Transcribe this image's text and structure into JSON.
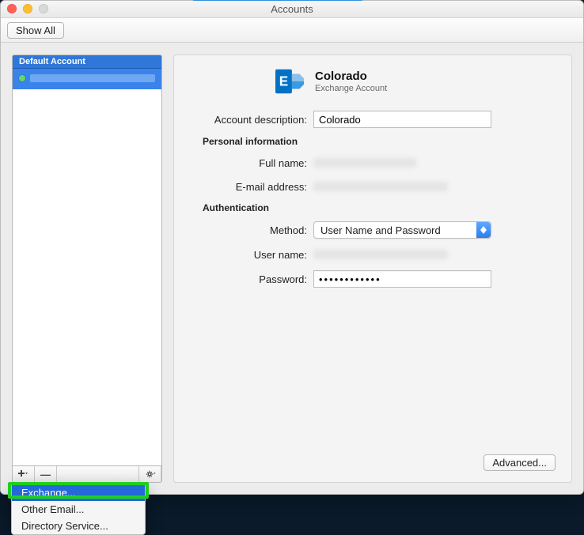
{
  "window": {
    "title": "Accounts"
  },
  "toolbar": {
    "show_all_label": "Show All"
  },
  "sidebar": {
    "header": "Default Account",
    "controls": {
      "add": "+",
      "remove": "−",
      "settings": "⚙"
    }
  },
  "popup": {
    "items": [
      {
        "label": "Exchange...",
        "selected": true
      },
      {
        "label": "Other Email..."
      },
      {
        "label": "Directory Service..."
      }
    ]
  },
  "detail": {
    "account_name": "Colorado",
    "account_type_label": "Exchange Account",
    "labels": {
      "description": "Account description:",
      "personal_section": "Personal information",
      "fullname": "Full name:",
      "email": "E-mail address:",
      "auth_section": "Authentication",
      "method": "Method:",
      "username": "User name:",
      "password": "Password:"
    },
    "values": {
      "description": "Colorado",
      "method": "User Name and Password",
      "password": "••••••••••••"
    },
    "advanced_label": "Advanced..."
  },
  "colors": {
    "selection": "#2f77d8",
    "exchange_brand": "#0072c6",
    "highlight": "#1fce1f"
  }
}
